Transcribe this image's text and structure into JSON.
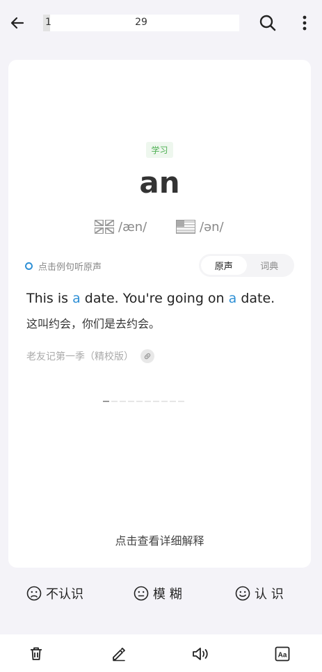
{
  "header": {
    "progress_current": "1",
    "progress_total": "29",
    "progress_fraction": 0.034
  },
  "card": {
    "tag": "学习",
    "word": "an",
    "phonetics": {
      "uk": "/æn/",
      "us": "/ən/"
    },
    "example_hint": "点击例句听原声",
    "source_tabs": [
      "原声",
      "词典"
    ],
    "active_tab": 0,
    "sentence_parts": [
      "This is ",
      "a",
      " date. You're going on ",
      "a",
      " date."
    ],
    "translation": "这叫约会，你们是去约会。",
    "source": "老友记第一季（精校版）",
    "pager": {
      "count": 10,
      "active": 0
    },
    "detail_hint": "点击查看详细解释"
  },
  "rating": {
    "unknown": "不认识",
    "vague": "模 糊",
    "known": "认 识"
  },
  "bottom_bar": {
    "icons": [
      "trash-icon",
      "edit-icon",
      "speaker-icon",
      "font-size-icon"
    ]
  },
  "colors": {
    "accent": "#2d8fd5",
    "tag_green": "#4caf50",
    "background": "#f4f3f8"
  }
}
